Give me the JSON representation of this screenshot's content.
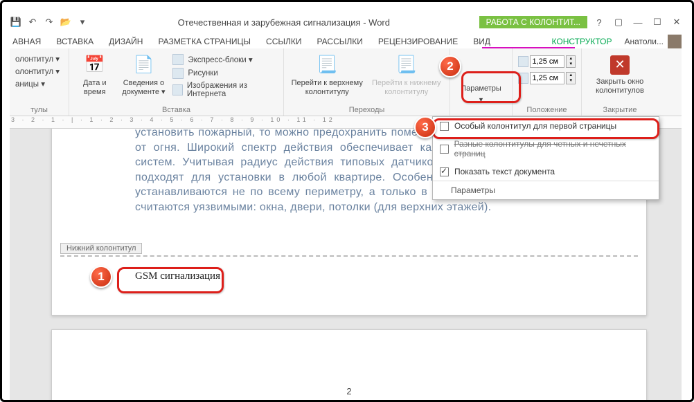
{
  "titlebar": {
    "doc_title": "Отечественная и зарубежная сигнализация - Word",
    "context_tab": "РАБОТА С КОЛОНТИТ..."
  },
  "tabs": {
    "home_partial": "АВНАЯ",
    "insert": "ВСТАВКА",
    "design": "ДИЗАЙН",
    "layout": "РАЗМЕТКА СТРАНИЦЫ",
    "references": "ССЫЛКИ",
    "mailings": "РАССЫЛКИ",
    "review": "РЕЦЕНЗИРОВАНИЕ",
    "view": "ВИД",
    "constructor": "КОНСТРУКТОР",
    "user": "Анатоли..."
  },
  "ribbon": {
    "hf": {
      "header": "олонтитул ▾",
      "footer": "олонтитул ▾",
      "pagenum": "аницы ▾",
      "group": "тулы"
    },
    "insert": {
      "datetime": "Дата и время",
      "docinfo": "Сведения о документе ▾",
      "quickparts": "Экспресс-блоки ▾",
      "pictures": "Рисунки",
      "onlinepics": "Изображения из Интернета",
      "group": "Вставка"
    },
    "nav": {
      "gototop": "Перейти к верхнему колонтитулу",
      "gotobottom": "Перейти к нижнему колонтитулу",
      "group": "Переходы"
    },
    "options": {
      "button": "Параметры",
      "group": "Параметры"
    },
    "position": {
      "top": "1,25 см",
      "bottom": "1,25 см",
      "group": "Положение"
    },
    "close": {
      "btn": "Закрыть окно колонтитулов",
      "group": "Закрытие"
    }
  },
  "dropdown": {
    "item1": "Особый колонтитул для первой страницы",
    "item2": "Разные колонтитулы для четных и нечетных страниц",
    "item3": "Показать текст документа",
    "footer": "Параметры"
  },
  "callouts": {
    "c1": "1",
    "c2": "2",
    "c3": "3"
  },
  "document": {
    "body": "установить пожарный, то можно предохранить помещение не только от хищения, но и от огня. Широкий спектр действия обеспечивает качество современных охранных систем. Учитывая радиус действия типовых датчиков (10 – 20 м), они прекрасно подходят для установки в любой квартире. Особенно, если учесть, что сенсоры устанавливаются не по всему периметру, а только в определенных местах, которые считаются уязвимыми: окна, двери, потолки (для верхних этажей).",
    "footer_tab": "Нижний колонтитул",
    "footer_text": "GSM сигнализация",
    "page_number": "2"
  },
  "ruler": "3 · 2 · 1 · | · 1 · 2 · 3 · 4 · 5 · 6 · 7 · 8 · 9 · 10 · 11 · 12"
}
